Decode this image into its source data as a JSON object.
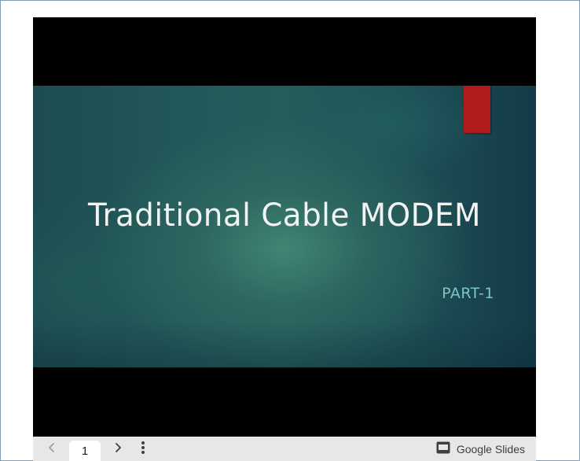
{
  "slide": {
    "title": "Traditional Cable MODEM",
    "subtitle": "PART-1"
  },
  "toolbar": {
    "page_number": "1",
    "brand_label": "Google Slides"
  },
  "icons": {
    "prev": "chevron-left-icon",
    "next": "chevron-right-icon",
    "menu": "more-vert-icon",
    "brand": "slides-logo-icon"
  },
  "colors": {
    "accent_red": "#b01c1c",
    "subtitle_teal": "#7fc4c4",
    "toolbar_bg": "#e7e7e7"
  }
}
